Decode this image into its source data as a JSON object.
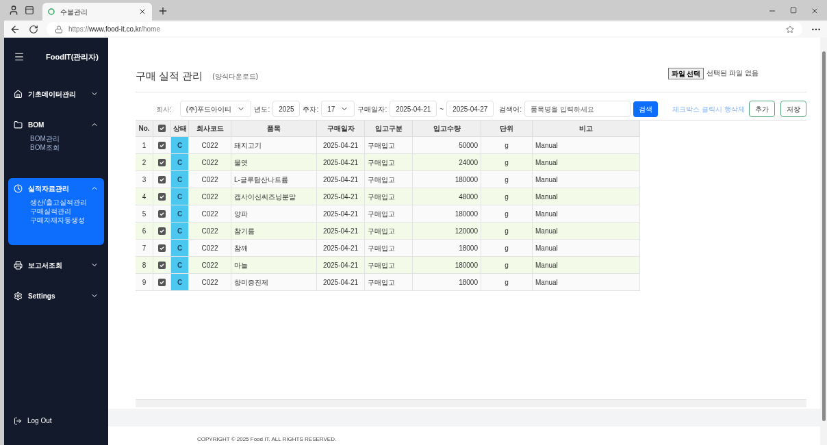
{
  "browser": {
    "tab_title": "수불관리",
    "url": "https://**www.food-it.co.kr**/home"
  },
  "sidebar": {
    "title": "FoodIT(관리자)",
    "items": [
      {
        "label": "기초데이터관리",
        "kind": "home",
        "expanded": false,
        "selected": false
      },
      {
        "label": "BOM",
        "kind": "folder",
        "expanded": true,
        "selected": false,
        "children": [
          {
            "label": "BOM관리"
          },
          {
            "label": "BOM조회"
          }
        ]
      },
      {
        "label": "실적자료관리",
        "kind": "chart",
        "expanded": true,
        "selected": true,
        "children": [
          {
            "label": "생산/출고실적관리"
          },
          {
            "label": "구매실적관리"
          },
          {
            "label": "구매자재자동생성"
          }
        ]
      },
      {
        "label": "보고서조회",
        "kind": "printer",
        "expanded": false,
        "selected": false
      },
      {
        "label": "Settings",
        "kind": "gear",
        "expanded": false,
        "selected": false
      }
    ],
    "logout": "Log Out"
  },
  "page": {
    "title": "구매 실적 관리",
    "subtitle": "(양식다운로드)",
    "file_button": "파일 선택",
    "file_status": "선택된 파일 없음"
  },
  "filters": {
    "company_label": "회사:",
    "company": "(주)푸드아이티",
    "year_label": "년도:",
    "year": "2025",
    "week_label": "주차:",
    "week": "17",
    "date_label": "구매일자:",
    "date_from": "2025-04-21",
    "tilde": "~",
    "date_to": "2025-04-27",
    "search_label": "검색어:",
    "search_placeholder": "품목명을 입력하세요",
    "search_button": "검색",
    "hint": "체크박스 클릭시 행삭제",
    "add_button": "추가",
    "save_button": "저장"
  },
  "table": {
    "columns": [
      "No.",
      "",
      "상태",
      "회사코드",
      "품목",
      "구매일자",
      "입고구분",
      "입고수량",
      "단위",
      "비고"
    ],
    "header_checked": true,
    "rows": [
      {
        "no": "1",
        "checked": true,
        "status": "C",
        "code": "C022",
        "item": "돼지고기",
        "date": "2025-04-21",
        "type": "구매입고",
        "qty": "50000",
        "unit": "g",
        "note": "Manual"
      },
      {
        "no": "2",
        "checked": true,
        "status": "C",
        "code": "C022",
        "item": "물엿",
        "date": "2025-04-21",
        "type": "구매입고",
        "qty": "24000",
        "unit": "g",
        "note": "Manual"
      },
      {
        "no": "3",
        "checked": true,
        "status": "C",
        "code": "C022",
        "item": "L-글루탐산나트륨",
        "date": "2025-04-21",
        "type": "구매입고",
        "qty": "180000",
        "unit": "g",
        "note": "Manual"
      },
      {
        "no": "4",
        "checked": true,
        "status": "C",
        "code": "C022",
        "item": "캡사이신씨즈닝분말",
        "date": "2025-04-21",
        "type": "구매입고",
        "qty": "48000",
        "unit": "g",
        "note": "Manual"
      },
      {
        "no": "5",
        "checked": true,
        "status": "C",
        "code": "C022",
        "item": "양파",
        "date": "2025-04-21",
        "type": "구매입고",
        "qty": "180000",
        "unit": "g",
        "note": "Manual"
      },
      {
        "no": "6",
        "checked": true,
        "status": "C",
        "code": "C022",
        "item": "참기름",
        "date": "2025-04-21",
        "type": "구매입고",
        "qty": "120000",
        "unit": "g",
        "note": "Manual"
      },
      {
        "no": "7",
        "checked": true,
        "status": "C",
        "code": "C022",
        "item": "참깨",
        "date": "2025-04-21",
        "type": "구매입고",
        "qty": "18000",
        "unit": "g",
        "note": "Manual"
      },
      {
        "no": "8",
        "checked": true,
        "status": "C",
        "code": "C022",
        "item": "마늘",
        "date": "2025-04-21",
        "type": "구매입고",
        "qty": "180000",
        "unit": "g",
        "note": "Manual"
      },
      {
        "no": "9",
        "checked": true,
        "status": "C",
        "code": "C022",
        "item": "향미증진제",
        "date": "2025-04-21",
        "type": "구매입고",
        "qty": "18000",
        "unit": "g",
        "note": "Manual"
      }
    ]
  },
  "footer": "COPYRIGHT © 2025 Food IT. ALL RIGHTS RESERVED."
}
